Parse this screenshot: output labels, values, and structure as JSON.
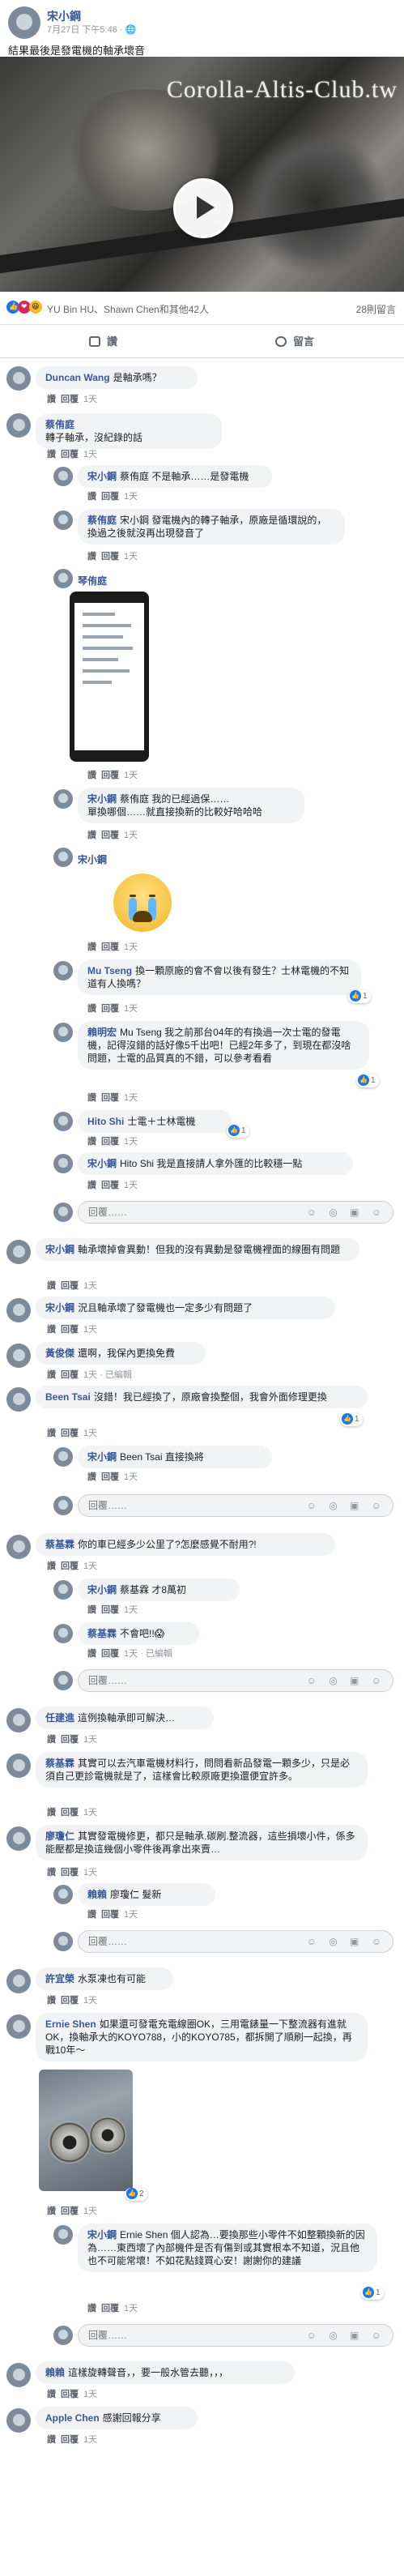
{
  "post": {
    "author": "宋小鋼",
    "time": "7月27日 下午5:46 · ",
    "text": "結果最後是發電機的軸承壞音",
    "watermark": "Corolla-Altis-Club.tw",
    "reactions_text": "YU Bin HU、Shawn Chen和其他42人",
    "shares": "28則留言",
    "like_label": "讚",
    "comment_label": "留言"
  },
  "common": {
    "like": "讚",
    "reply": "回覆",
    "time_1w": "1天",
    "edited": "已編輯",
    "reply_placeholder": "回覆……",
    "input_icons": "☺ ◎ ▣ ☺"
  },
  "comments": [
    {
      "name": "Duncan Wang",
      "text": "是軸承嗎？"
    },
    {
      "name": "蔡侑庭",
      "text": "轉子軸承，沒紀錄的話"
    },
    {
      "name": "宋小鋼",
      "text": "蔡侑庭 不是軸承……是發電機"
    },
    {
      "name": "蔡侑庭",
      "text": "宋小鋼 發電機內的轉子軸承，原廠是循環說的，換過之後就沒再出現發音了"
    },
    {
      "name": "琴侑庭",
      "text": ""
    },
    {
      "name": "宋小鋼",
      "text": "蔡侑庭 我的已經過保……"
    },
    {
      "name": "",
      "text": "單換哪個……就直接換新的比較好哈哈哈"
    },
    {
      "name": "宋小鋼",
      "text": ""
    },
    {
      "name": "Mu Tseng",
      "text": "換一顆原廠的會不會以後有發生？士林電機的不知道有人換嗎？"
    },
    {
      "name": "賴明宏",
      "text": "Mu Tseng 我之前那台04年的有換過一次士電的發電機，記得沒錯的話好像5千出吧！已經2年多了，到現在都沒啥問題，士電的品質真的不錯，可以參考看看"
    },
    {
      "name": "Hito Shi",
      "text": "士電＋士林電機"
    },
    {
      "name": "宋小鋼",
      "text": "Hito Shi 我是直接請人拿外匯的比較穩一點"
    },
    {
      "name": "宋小鋼",
      "text": "軸承壞掉會異動！但我的沒有異動是發電機裡面的線圈有問題"
    },
    {
      "name": "宋小鋼",
      "text": "況且軸承壞了發電機也一定多少有問題了"
    },
    {
      "name": "黃俊傑",
      "text": "還啊，我保內更換免費"
    },
    {
      "name": "Been Tsai",
      "text": "沒錯！我已經換了，原廠會換整個，我會外面修理更換"
    },
    {
      "name": "宋小鋼",
      "text": "Been Tsai 直接換將"
    },
    {
      "name": "蔡基霖",
      "text": "你的車已經多少公里了?怎麼感覺不耐用?!"
    },
    {
      "name": "宋小鋼",
      "text": "蔡基霖 才8萬初"
    },
    {
      "name": "蔡基霖",
      "text": "不會吧!!😱"
    },
    {
      "name": "任建進",
      "text": "這例換軸承即可解決…"
    },
    {
      "name": "蔡基霖",
      "text": "其實可以去汽車電機材料行，問問看新品發電一顆多少，只是必須自己更診電機就是了，這樣會比較原廠更換還便宜許多。"
    },
    {
      "name": "廖瓊仁",
      "text": "其實發電機修更，都只是軸承.碳刷.整流器，這些損壞小件，係多能壓都是換這幾個小零件後再拿出來賣…"
    },
    {
      "name": "賴賴",
      "text": "廖瓊仁 髮新"
    },
    {
      "name": "許宜榮",
      "text": "水泵凍也有可能"
    },
    {
      "name": "Ernie Shen",
      "text": "如果還可發電充電線圈OK，三用電錶量一下整流器有進就OK，換軸承大的KOYO788，小的KOYO785，都拆開了順刷一起換，再戰10年～"
    },
    {
      "name": "宋小鋼",
      "text": "Ernie Shen 個人認為…要換那些小零件不如整顆換新的因為……東西壞了內部機件是否有傷到或其實根本不知道，況且他也不可能常壞！不如花點錢買心安！謝謝你的建議"
    },
    {
      "name": "賴賴",
      "text": "這樣旋轉聲音，，要一般水管去聽，，，"
    },
    {
      "name": "Apple Chen",
      "text": "感謝回報分享"
    }
  ],
  "likes": {
    "c9": "1",
    "c10": "1",
    "c11": "1",
    "c15": "1",
    "c26": "2",
    "c27": "1"
  }
}
